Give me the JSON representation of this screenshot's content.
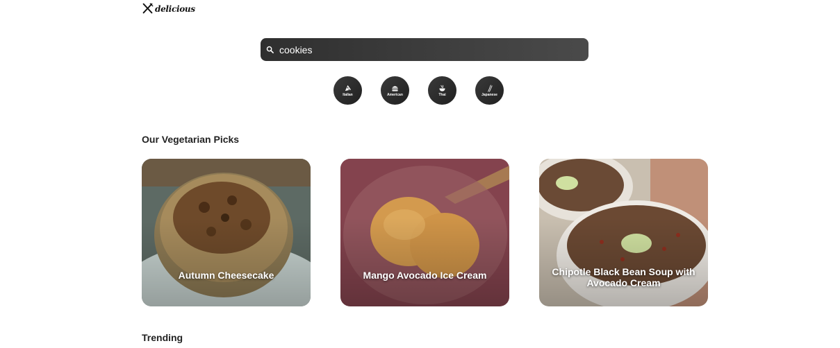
{
  "brand": {
    "logo_text": "delicious",
    "logo_icon": "fork-knife-icon"
  },
  "search": {
    "value": "cookies",
    "placeholder": "",
    "icon": "search-icon"
  },
  "cuisines": [
    {
      "label": "Italian",
      "icon": "pizza-icon"
    },
    {
      "label": "American",
      "icon": "burger-icon"
    },
    {
      "label": "Thai",
      "icon": "noodle-bowl-icon"
    },
    {
      "label": "Japanese",
      "icon": "chopsticks-icon"
    }
  ],
  "sections": {
    "veggie_title": "Our Vegetarian Picks",
    "trending_title": "Trending"
  },
  "veggie_picks": [
    {
      "title": "Autumn Cheesecake"
    },
    {
      "title": "Mango Avocado Ice Cream"
    },
    {
      "title": "Chipotle Black Bean Soup with Avocado Cream"
    }
  ],
  "colors": {
    "search_bg": "#3a3a3a",
    "cuisine_bg": "#2a2a2a",
    "text_dark": "#222222"
  }
}
